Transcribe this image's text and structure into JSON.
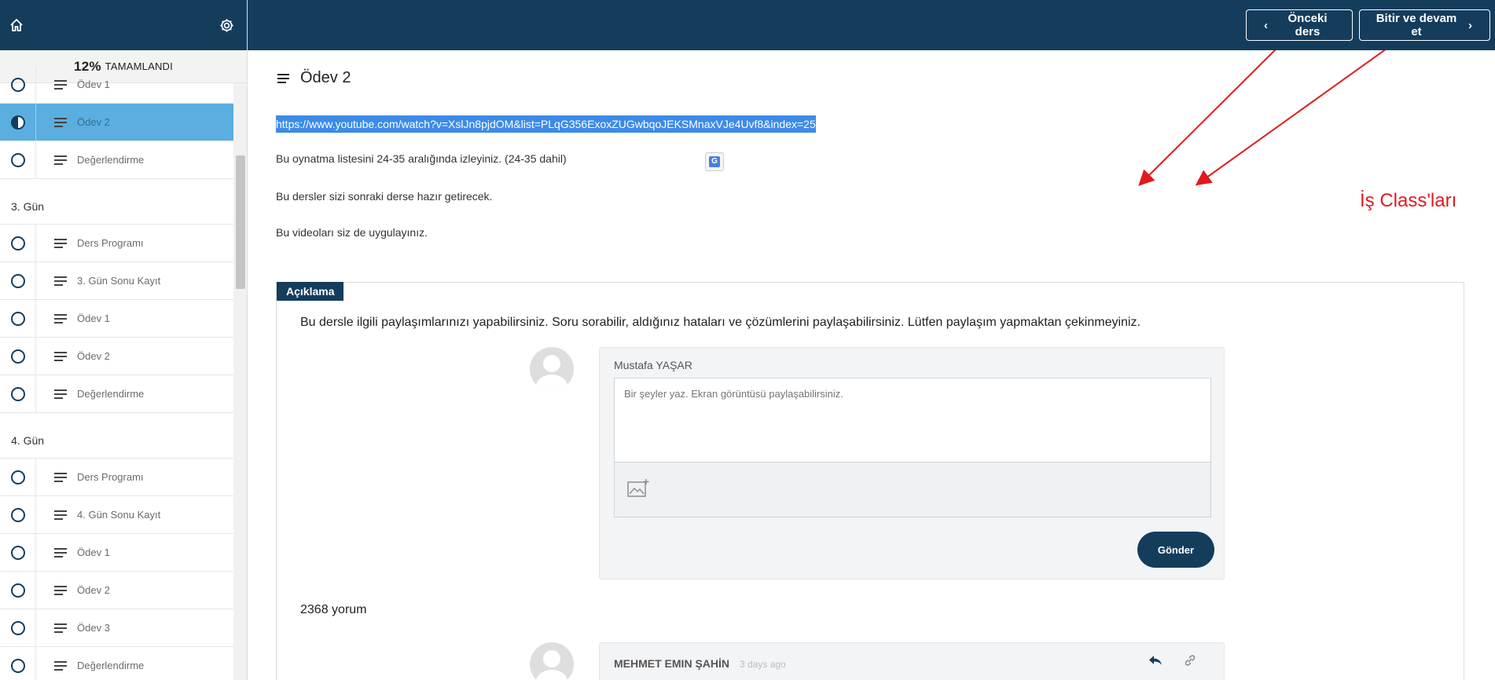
{
  "sidebar": {
    "progress_percent": "12%",
    "progress_label": "TAMAMLANDI",
    "items": [
      {
        "type": "lesson",
        "label": "Ödev 1",
        "status": "empty"
      },
      {
        "type": "lesson",
        "label": "Ödev 2",
        "status": "half",
        "active": true
      },
      {
        "type": "lesson",
        "label": "Değerlendirme",
        "status": "empty"
      },
      {
        "type": "section",
        "label": "3. Gün"
      },
      {
        "type": "lesson",
        "label": "Ders Programı",
        "status": "empty"
      },
      {
        "type": "lesson",
        "label": "3. Gün Sonu Kayıt",
        "status": "empty"
      },
      {
        "type": "lesson",
        "label": "Ödev 1",
        "status": "empty"
      },
      {
        "type": "lesson",
        "label": "Ödev 2",
        "status": "empty"
      },
      {
        "type": "lesson",
        "label": "Değerlendirme",
        "status": "empty"
      },
      {
        "type": "section",
        "label": "4. Gün"
      },
      {
        "type": "lesson",
        "label": "Ders Programı",
        "status": "empty"
      },
      {
        "type": "lesson",
        "label": "4. Gün Sonu Kayıt",
        "status": "empty"
      },
      {
        "type": "lesson",
        "label": "Ödev 1",
        "status": "empty"
      },
      {
        "type": "lesson",
        "label": "Ödev 2",
        "status": "empty"
      },
      {
        "type": "lesson",
        "label": "Ödev 3",
        "status": "empty"
      },
      {
        "type": "lesson",
        "label": "Değerlendirme",
        "status": "empty"
      }
    ]
  },
  "topbar": {
    "prev_label": "Önceki ders",
    "next_label": "Bitir ve devam et"
  },
  "lesson": {
    "title": "Ödev 2",
    "link": "https://www.youtube.com/watch?v=XslJn8pjdOM&list=PLqG356ExoxZUGwbqoJEKSMnaxVJe4Uvf8&index=25",
    "paragraphs": [
      "Bu oynatma listesini 24-35 aralığında izleyiniz. (24-35 dahil)",
      "Bu dersler sizi sonraki derse hazır getirecek.",
      "Bu videoları siz de uygulayınız."
    ]
  },
  "annotation": "İş Class'ları",
  "discussion": {
    "tag": "Açıklama",
    "description": "Bu dersle ilgili paylaşımlarınızı yapabilirsiniz. Soru sorabilir, aldığınız hataları ve çözümlerini paylaşabilirsiniz. Lütfen paylaşım yapmaktan çekinmeyiniz.",
    "current_user": "Mustafa YAŞAR",
    "placeholder": "Bir şeyler yaz. Ekran görüntüsü paylaşabilirsiniz.",
    "send_label": "Gönder",
    "comment_count": "2368 yorum",
    "comments": [
      {
        "user": "MEHMET EMIN ŞAHİN",
        "time": "3 days ago"
      }
    ]
  },
  "colors": {
    "primary": "#143d5c",
    "active_item": "#5aaee0",
    "link_highlight": "#3d8be8",
    "annotation": "#e01b1b"
  }
}
